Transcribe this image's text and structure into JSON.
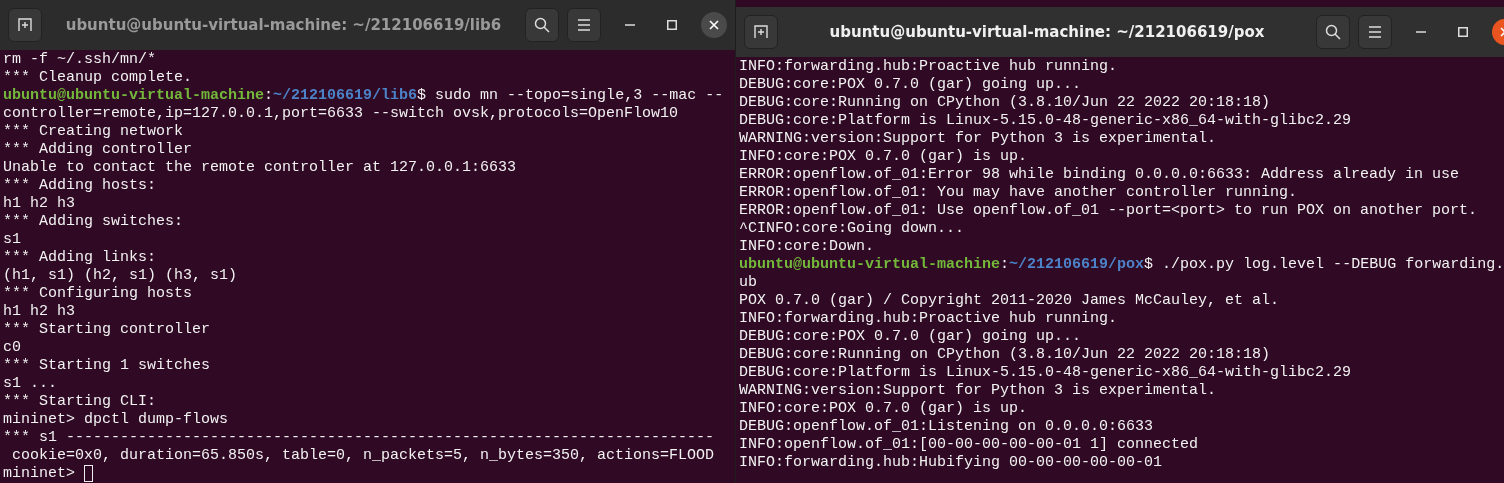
{
  "windows": [
    {
      "title": "ubuntu@ubuntu-virtual-machine: ~/212106619/lib6",
      "focused": false,
      "lines": [
        {
          "kind": "output",
          "text": "rm -f ~/.ssh/mn/*"
        },
        {
          "kind": "output",
          "text": "*** Cleanup complete."
        },
        {
          "kind": "prompt",
          "user": "ubuntu@ubuntu-virtual-machine",
          "separator": ":",
          "path": "~/212106619/lib6",
          "command": "$ sudo mn --topo=single,3 --mac --"
        },
        {
          "kind": "output",
          "text": "controller=remote,ip=127.0.0.1,port=6633 --switch ovsk,protocols=OpenFlow10"
        },
        {
          "kind": "output",
          "text": "*** Creating network"
        },
        {
          "kind": "output",
          "text": "*** Adding controller"
        },
        {
          "kind": "output",
          "text": "Unable to contact the remote controller at 127.0.0.1:6633"
        },
        {
          "kind": "output",
          "text": "*** Adding hosts:"
        },
        {
          "kind": "output",
          "text": "h1 h2 h3"
        },
        {
          "kind": "output",
          "text": "*** Adding switches:"
        },
        {
          "kind": "output",
          "text": "s1"
        },
        {
          "kind": "output",
          "text": "*** Adding links:"
        },
        {
          "kind": "output",
          "text": "(h1, s1) (h2, s1) (h3, s1)"
        },
        {
          "kind": "output",
          "text": "*** Configuring hosts"
        },
        {
          "kind": "output",
          "text": "h1 h2 h3"
        },
        {
          "kind": "output",
          "text": "*** Starting controller"
        },
        {
          "kind": "output",
          "text": "c0"
        },
        {
          "kind": "output",
          "text": "*** Starting 1 switches"
        },
        {
          "kind": "output",
          "text": "s1 ..."
        },
        {
          "kind": "output",
          "text": "*** Starting CLI:"
        },
        {
          "kind": "output",
          "text": "mininet> dpctl dump-flows"
        },
        {
          "kind": "output",
          "text": "*** s1 ------------------------------------------------------------------------"
        },
        {
          "kind": "output",
          "text": " cookie=0x0, duration=65.850s, table=0, n_packets=5, n_bytes=350, actions=FLOOD"
        },
        {
          "kind": "input",
          "text": "mininet> "
        }
      ]
    },
    {
      "title": "ubuntu@ubuntu-virtual-machine: ~/212106619/pox",
      "focused": true,
      "lines": [
        {
          "kind": "output",
          "text": "INFO:forwarding.hub:Proactive hub running."
        },
        {
          "kind": "output",
          "text": "DEBUG:core:POX 0.7.0 (gar) going up..."
        },
        {
          "kind": "output",
          "text": "DEBUG:core:Running on CPython (3.8.10/Jun 22 2022 20:18:18)"
        },
        {
          "kind": "output",
          "text": "DEBUG:core:Platform is Linux-5.15.0-48-generic-x86_64-with-glibc2.29"
        },
        {
          "kind": "output",
          "text": "WARNING:version:Support for Python 3 is experimental."
        },
        {
          "kind": "output",
          "text": "INFO:core:POX 0.7.0 (gar) is up."
        },
        {
          "kind": "output",
          "text": "ERROR:openflow.of_01:Error 98 while binding 0.0.0.0:6633: Address already in use"
        },
        {
          "kind": "output",
          "text": "ERROR:openflow.of_01: You may have another controller running."
        },
        {
          "kind": "output",
          "text": "ERROR:openflow.of_01: Use openflow.of_01 --port=<port> to run POX on another port."
        },
        {
          "kind": "output",
          "text": "^CINFO:core:Going down..."
        },
        {
          "kind": "output",
          "text": "INFO:core:Down."
        },
        {
          "kind": "prompt",
          "user": "ubuntu@ubuntu-virtual-machine",
          "separator": ":",
          "path": "~/212106619/pox",
          "command": "$ ./pox.py log.level --DEBUG forwarding."
        },
        {
          "kind": "output",
          "text": "ub"
        },
        {
          "kind": "output",
          "text": "POX 0.7.0 (gar) / Copyright 2011-2020 James McCauley, et al."
        },
        {
          "kind": "output",
          "text": "INFO:forwarding.hub:Proactive hub running."
        },
        {
          "kind": "output",
          "text": "DEBUG:core:POX 0.7.0 (gar) going up..."
        },
        {
          "kind": "output",
          "text": "DEBUG:core:Running on CPython (3.8.10/Jun 22 2022 20:18:18)"
        },
        {
          "kind": "output",
          "text": "DEBUG:core:Platform is Linux-5.15.0-48-generic-x86_64-with-glibc2.29"
        },
        {
          "kind": "output",
          "text": "WARNING:version:Support for Python 3 is experimental."
        },
        {
          "kind": "output",
          "text": "INFO:core:POX 0.7.0 (gar) is up."
        },
        {
          "kind": "output",
          "text": "DEBUG:openflow.of_01:Listening on 0.0.0.0:6633"
        },
        {
          "kind": "output",
          "text": "INFO:openflow.of_01:[00-00-00-00-00-01 1] connected"
        },
        {
          "kind": "output",
          "text": "INFO:forwarding.hub:Hubifying 00-00-00-00-00-01"
        }
      ]
    }
  ]
}
